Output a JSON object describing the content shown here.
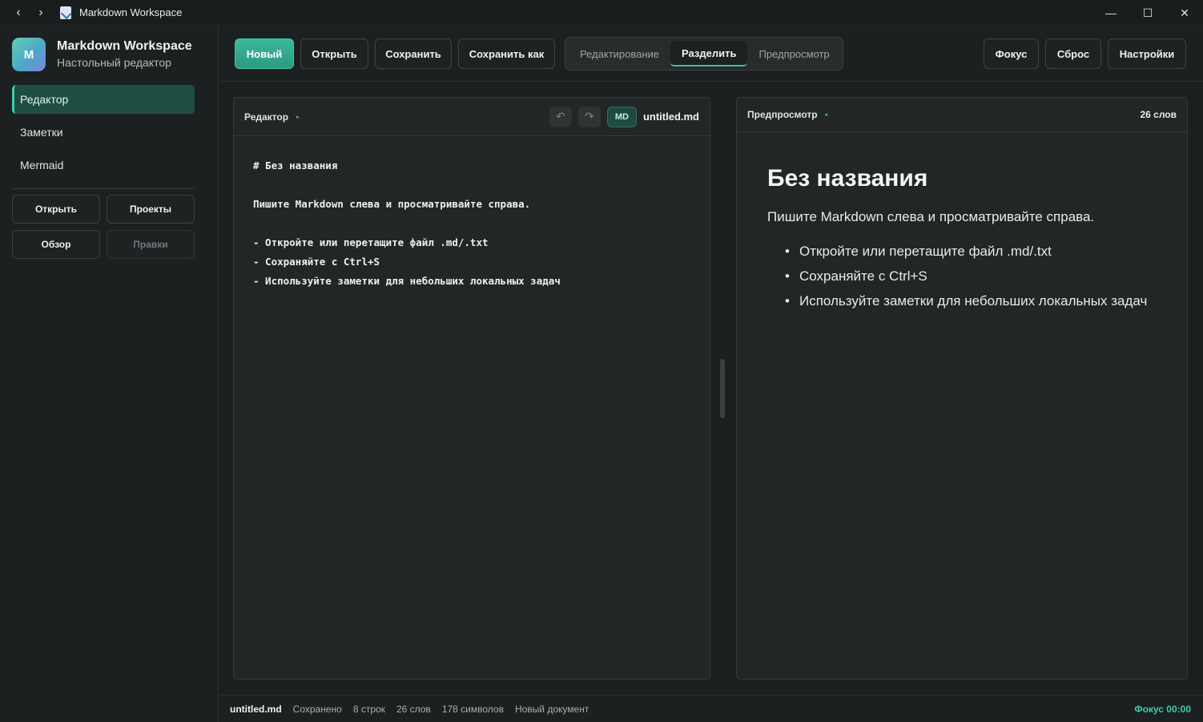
{
  "window": {
    "title": "Markdown Workspace",
    "back": "‹",
    "forward": "›",
    "minimize": "—",
    "maximize": "☐",
    "close": "✕"
  },
  "brand": {
    "logo_letter": "M",
    "title": "Markdown Workspace",
    "subtitle": "Настольный редактор"
  },
  "sidebar": {
    "nav": [
      {
        "label": "Редактор",
        "active": true
      },
      {
        "label": "Заметки",
        "active": false
      },
      {
        "label": "Mermaid",
        "active": false
      }
    ],
    "buttons": [
      {
        "label": "Открыть",
        "disabled": false
      },
      {
        "label": "Проекты",
        "disabled": false
      },
      {
        "label": "Обзор",
        "disabled": false
      },
      {
        "label": "Правки",
        "disabled": true
      }
    ]
  },
  "toolbar": {
    "new": "Новый",
    "open": "Открыть",
    "save": "Сохранить",
    "save_as": "Сохранить как",
    "modes": [
      {
        "label": "Редактирование",
        "active": false
      },
      {
        "label": "Разделить",
        "active": true
      },
      {
        "label": "Предпросмотр",
        "active": false
      }
    ],
    "focus": "Фокус",
    "reset": "Сброс",
    "settings": "Настройки"
  },
  "editor": {
    "label": "Редактор",
    "arrow": "▸",
    "undo_icon": "↶",
    "redo_icon": "↷",
    "badge": "MD",
    "filename": "untitled.md",
    "content": "# Без названия\n\nПишите Markdown слева и просматривайте справа.\n\n- Откройте или перетащите файл .md/.txt\n- Сохраняйте с Ctrl+S\n- Используйте заметки для небольших локальных задач"
  },
  "preview": {
    "label": "Предпросмотр",
    "arrow": "▸",
    "word_count": "26 слов",
    "heading": "Без названия",
    "paragraph": "Пишите Markdown слева и просматривайте справа.",
    "list": [
      "Откройте или перетащите файл .md/.txt",
      "Сохраняйте с Ctrl+S",
      "Используйте заметки для небольших локальных задач"
    ]
  },
  "status": {
    "file": "untitled.md",
    "state": "Сохранено",
    "lines": "8 строк",
    "words": "26 слов",
    "chars": "178 символов",
    "doc": "Новый документ",
    "focus_timer": "Фокус 00:00"
  },
  "colors": {
    "accent": "#3ccfa9",
    "background": "#1b1f1f",
    "panel": "#222626"
  }
}
